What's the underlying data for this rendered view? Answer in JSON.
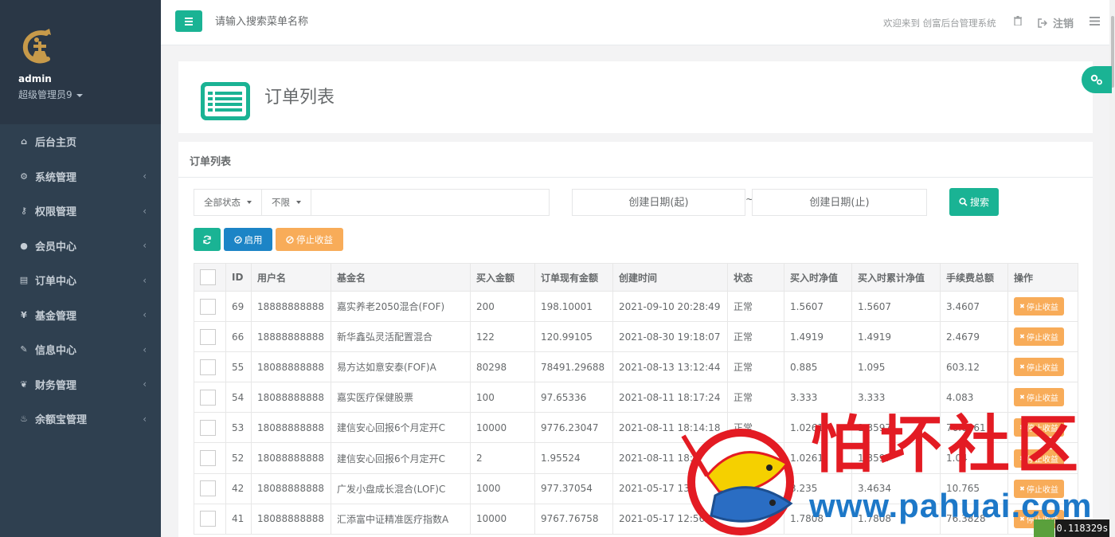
{
  "sidebar": {
    "profile": {
      "name": "admin",
      "role": "超级管理员9"
    },
    "items": [
      {
        "label": "后台主页",
        "icon": "home-icon",
        "has_children": false
      },
      {
        "label": "系统管理",
        "icon": "cogs-icon",
        "has_children": true
      },
      {
        "label": "权限管理",
        "icon": "key-icon",
        "has_children": true
      },
      {
        "label": "会员中心",
        "icon": "user-icon",
        "has_children": true
      },
      {
        "label": "订单中心",
        "icon": "list-alt-icon",
        "has_children": true
      },
      {
        "label": "基金管理",
        "icon": "yen-icon",
        "has_children": true
      },
      {
        "label": "信息中心",
        "icon": "wrench-icon",
        "has_children": true
      },
      {
        "label": "财务管理",
        "icon": "leaf-icon",
        "has_children": true
      },
      {
        "label": "余额宝管理",
        "icon": "fire-icon",
        "has_children": true
      }
    ]
  },
  "topbar": {
    "search_placeholder": "请输入搜索菜单名称",
    "welcome": "欢迎来到 创富后台管理系统",
    "logout_label": "注销"
  },
  "page": {
    "title": "订单列表"
  },
  "panel": {
    "title": "订单列表",
    "filters": {
      "status_label": "全部状态",
      "limit_label": "不限",
      "date_start_placeholder": "创建日期(起)",
      "date_sep": "~",
      "date_end_placeholder": "创建日期(止)",
      "search_label": "搜索"
    },
    "toolbar": {
      "enable_label": "启用",
      "stop_label": "停止收益"
    },
    "table": {
      "columns": [
        "ID",
        "用户名",
        "基金名",
        "买入金额",
        "订单现有金额",
        "创建时间",
        "状态",
        "买入时净值",
        "买入时累计净值",
        "手续费总额",
        "操作"
      ],
      "op_label": "停止收益",
      "rows": [
        [
          "69",
          "18888888888",
          "嘉实养老2050混合(FOF)",
          "200",
          "198.10001",
          "2021-09-10 20:28:49",
          "正常",
          "1.5607",
          "1.5607",
          "3.4607"
        ],
        [
          "66",
          "18888888888",
          "新华鑫弘灵活配置混合",
          "122",
          "120.99105",
          "2021-08-30 19:18:07",
          "正常",
          "1.4919",
          "1.4919",
          "2.4679"
        ],
        [
          "55",
          "18088888888",
          "易方达如意安泰(FOF)A",
          "80298",
          "78491.29688",
          "2021-08-13 13:12:44",
          "正常",
          "0.885",
          "1.095",
          "603.12"
        ],
        [
          "54",
          "18088888888",
          "嘉实医疗保健股票",
          "100",
          "97.65336",
          "2021-08-11 18:17:24",
          "正常",
          "3.333",
          "3.333",
          "4.083"
        ],
        [
          "53",
          "18088888888",
          "建信安心回报6个月定开C",
          "10000",
          "9776.23047",
          "2021-08-11 18:14:18",
          "正常",
          "1.0261",
          "1.3597",
          "76.0661"
        ],
        [
          "52",
          "18088888888",
          "建信安心回报6个月定开C",
          "2",
          "1.95524",
          "2021-08-11 18:08:41",
          "正常",
          "1.0261",
          "1.3597",
          "1.04"
        ],
        [
          "42",
          "18088888888",
          "广发小盘成长混合(LOF)C",
          "1000",
          "977.37054",
          "2021-05-17 13:01:11",
          "正常",
          "3.235",
          "3.4634",
          "10.765"
        ],
        [
          "41",
          "18088888888",
          "汇添富中证精准医疗指数A",
          "10000",
          "9767.76758",
          "2021-05-17 12:56:35",
          "正常",
          "1.7808",
          "1.7808",
          "76.3828"
        ]
      ]
    }
  },
  "watermark": {
    "text": "怕坏社区",
    "url": "www.pahuai.com"
  },
  "timer": "0.118329s",
  "colors": {
    "primary": "#1ab394",
    "info": "#1c84c6",
    "warning": "#f8ac59",
    "sidebar": "#2f4050"
  }
}
